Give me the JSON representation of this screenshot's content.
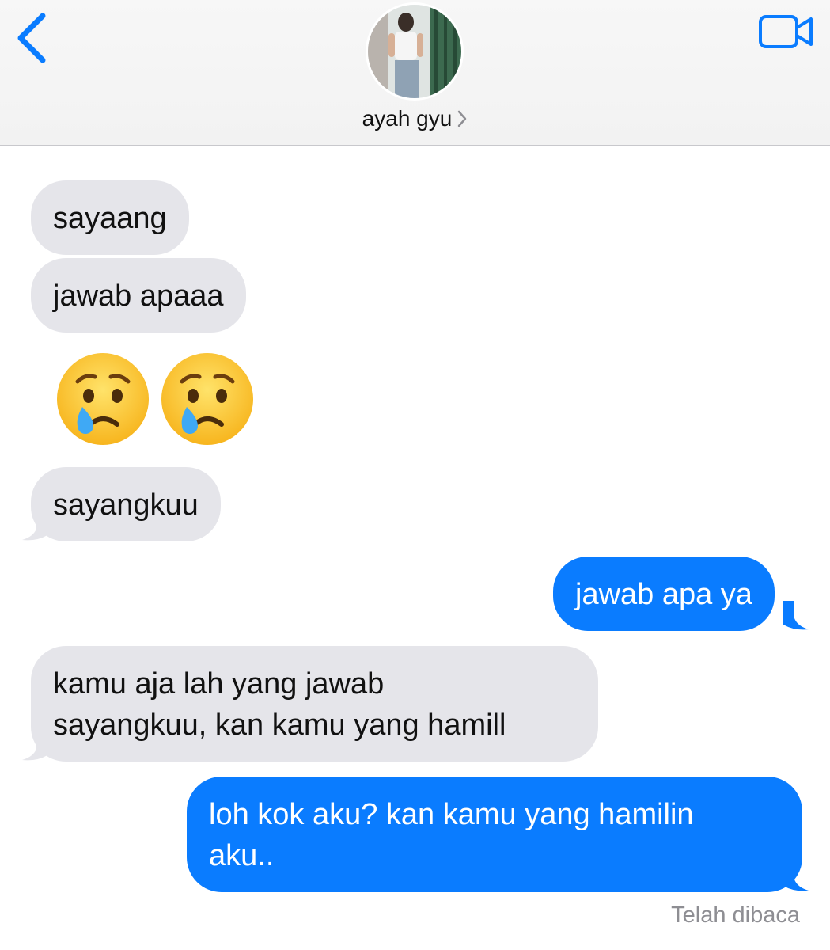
{
  "header": {
    "contact_name": "ayah gyu",
    "icons": {
      "back": "chevron-left-icon",
      "video": "video-camera-icon",
      "contact_chevron": "chevron-right-icon"
    },
    "accent_color": "#0a7cff"
  },
  "messages": [
    {
      "direction": "incoming",
      "text": "sayaang"
    },
    {
      "direction": "incoming",
      "text": "jawab apaaa"
    },
    {
      "direction": "incoming",
      "type": "emoji",
      "emoji": [
        "crying-face-emoji",
        "crying-face-emoji"
      ]
    },
    {
      "direction": "incoming",
      "text": "sayangkuu"
    },
    {
      "direction": "outgoing",
      "text": "jawab apa ya"
    },
    {
      "direction": "incoming",
      "lines": [
        "kamu aja lah yang jawab",
        "sayangkuu, kan kamu yang hamill"
      ]
    },
    {
      "direction": "outgoing",
      "lines": [
        "loh kok aku? kan kamu yang hamilin",
        "aku.."
      ]
    }
  ],
  "status": {
    "read_receipt": "Telah dibaca"
  },
  "colors": {
    "incoming_bubble": "#e5e5ea",
    "outgoing_bubble": "#0a7cff"
  }
}
